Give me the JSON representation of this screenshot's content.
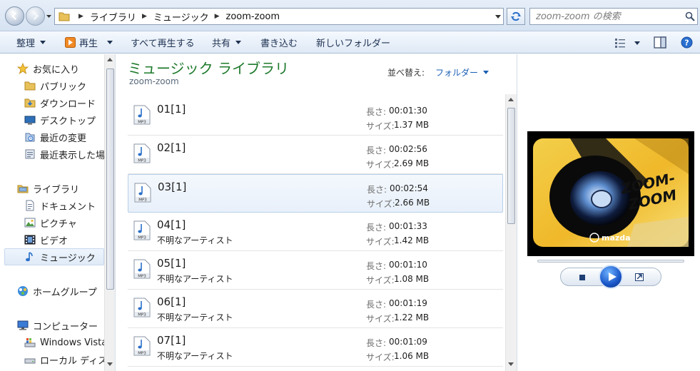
{
  "addressbar": {
    "crumbs": [
      "ライブラリ",
      "ミュージック",
      "zoom-zoom"
    ],
    "search_placeholder": "zoom-zoom の検索"
  },
  "toolbar": {
    "organize": "整理",
    "play": "再生",
    "play_all": "すべて再生する",
    "share": "共有",
    "burn": "書き込む",
    "new_folder": "新しいフォルダー"
  },
  "nav": {
    "favorites": "お気に入り",
    "public": "パブリック",
    "downloads": "ダウンロード",
    "desktop": "デスクトップ",
    "recent_changes": "最近の変更",
    "recent_places": "最近表示した場所",
    "libraries": "ライブラリ",
    "documents": "ドキュメント",
    "pictures": "ピクチャ",
    "videos": "ビデオ",
    "music": "ミュージック",
    "homegroup": "ホームグループ",
    "computer": "コンピューター",
    "windows_vista": "Windows Vista",
    "local_disk": "ローカル ディスク"
  },
  "content": {
    "title": "ミュージック ライブラリ",
    "subtitle": "zoom-zoom",
    "sort_label": "並べ替え:",
    "sort_value": "フォルダー",
    "icon_label": "MP3",
    "length_label": "長さ:",
    "size_label": "サイズ:",
    "files": [
      {
        "name": "01[1]",
        "artist": "",
        "length": "00:01:30",
        "size": "1.37 MB"
      },
      {
        "name": "02[1]",
        "artist": "",
        "length": "00:02:56",
        "size": "2.69 MB"
      },
      {
        "name": "03[1]",
        "artist": "",
        "length": "00:02:54",
        "size": "2.66 MB"
      },
      {
        "name": "04[1]",
        "artist": "不明なアーティスト",
        "length": "00:01:33",
        "size": "1.42 MB"
      },
      {
        "name": "05[1]",
        "artist": "不明なアーティスト",
        "length": "00:01:10",
        "size": "1.08 MB"
      },
      {
        "name": "06[1]",
        "artist": "不明なアーティスト",
        "length": "00:01:19",
        "size": "1.22 MB"
      },
      {
        "name": "07[1]",
        "artist": "不明なアーティスト",
        "length": "00:01:09",
        "size": "1.06 MB"
      }
    ]
  },
  "preview": {
    "art_text_1": "ZOOM-",
    "art_text_2": "ZOOM",
    "brand": "mazda"
  }
}
